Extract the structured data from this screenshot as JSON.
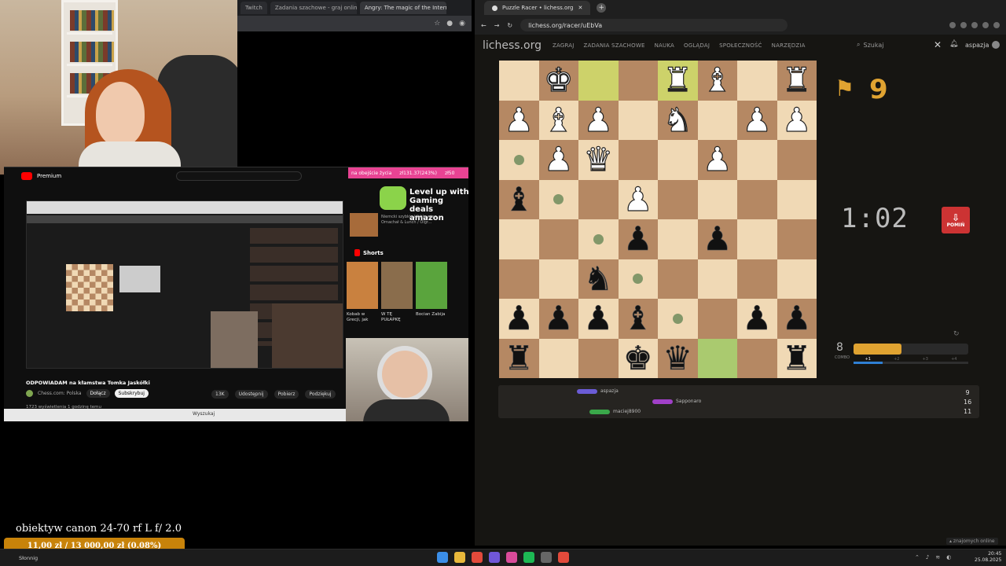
{
  "left_browser": {
    "tabs": [
      "Twitch",
      "Zadania szachowe - graj online",
      "Angry: The magic of the Internet"
    ]
  },
  "youtube": {
    "logo": "Premium",
    "banner_left": "na obejście życia",
    "banner_mid": "zł131.37(243%)",
    "banner_right": "zł50",
    "ad_title": "Level up with Gaming deals",
    "ad_brand": "amazon",
    "ad_lines": [
      "Niemcki szybkie kibble więc",
      "Ornachał & Lunch / Olgr..."
    ],
    "shorts_label": "Shorts",
    "shorts": [
      {
        "title": "Kobab w Grecji, jak",
        "color": "#c9813f"
      },
      {
        "title": "W TĘ PUŁAPKĘ",
        "color": "#8a6d4c"
      },
      {
        "title": "Bocian Zabija",
        "color": "#5aa43d"
      }
    ],
    "video_title": "ODPOWIADAM na kłamstwa Tomka Jaskółki",
    "channel": "Chess.com: Polska",
    "btn_join": "Dołącz",
    "btn_subscribe": "Subskrybuj",
    "actions": [
      "13K",
      "Udostępnij",
      "Pobierz",
      "Podziękuj"
    ],
    "views": "1723 wyświetlenia  1 godzinę temu",
    "taskbar_search": "Wyszukaj"
  },
  "right_browser": {
    "tab_title": "Puzzle Racer • lichess.org",
    "url": "lichess.org/racer/uEbVa",
    "new_tab": "+"
  },
  "lichess": {
    "logo": "lichess.org",
    "menu": [
      "ZAGRAJ",
      "ZADANIA SZACHOWE",
      "NAUKA",
      "OGLĄDAJ",
      "SPOŁECZNOŚĆ",
      "NARZĘDZIA"
    ],
    "search_placeholder": "Szukaj",
    "username": "aspazja",
    "race_score": "9",
    "clock": "1:02",
    "skip_label": "POMIŃ",
    "combo_count": "8",
    "combo_label": "COMBO",
    "combo_fill": 0.42,
    "combo_steps": [
      "+1",
      "+2",
      "+3",
      "+4"
    ],
    "racers": [
      {
        "name": "aspazja",
        "color": "#6b5cd6"
      },
      {
        "name": "Sapponaro",
        "color": "#a040c8"
      },
      {
        "name": "maciej8900",
        "color": "#3aa84a"
      }
    ],
    "positions": [
      "9",
      "16",
      "11"
    ],
    "online": "znajomych online"
  },
  "board": [
    [
      "",
      "wK",
      "",
      "",
      "wR",
      "wB",
      "",
      "wR"
    ],
    [
      "wP",
      "wB",
      "wP",
      "",
      "wN",
      "",
      "wP",
      "wP"
    ],
    [
      "",
      "wP",
      "wQ",
      "",
      "",
      "wP",
      "",
      ""
    ],
    [
      "bB",
      "",
      "",
      "wP",
      "",
      "",
      "",
      ""
    ],
    [
      "",
      "",
      "",
      "bP",
      "",
      "bP",
      "",
      ""
    ],
    [
      "",
      "",
      "bN",
      "",
      "",
      "",
      "",
      ""
    ],
    [
      "bP",
      "bP",
      "bP",
      "bB",
      "",
      "",
      "bP",
      "bP"
    ],
    [
      "bR",
      "",
      "",
      "bK",
      "bQ",
      "",
      "",
      "bR"
    ]
  ],
  "board_highlights": [
    [
      0,
      2,
      "hl"
    ],
    [
      0,
      4,
      "hl"
    ],
    [
      7,
      5,
      "grn"
    ]
  ],
  "board_dots": [
    [
      2,
      0
    ],
    [
      3,
      1
    ],
    [
      4,
      2
    ],
    [
      5,
      3
    ],
    [
      6,
      4
    ]
  ],
  "overlay": {
    "lens_text": "obiektyw canon 24-70 rf L f/ 2.0",
    "goal_text": "11,00 zł / 13 000,00 zł (0.08%)"
  },
  "taskbar": {
    "weather": "Słonnig",
    "time": "20:45",
    "date": "25.08.2025"
  }
}
